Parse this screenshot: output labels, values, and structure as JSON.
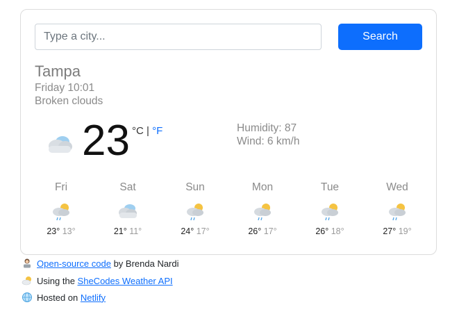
{
  "search": {
    "placeholder": "Type a city...",
    "value": "",
    "button_label": "Search"
  },
  "current": {
    "city": "Tampa",
    "datetime": "Friday 10:01",
    "description": "Broken clouds",
    "icon": "broken-clouds-icon",
    "temperature": "23",
    "unit_c": "°C",
    "unit_separator": " | ",
    "unit_f": "°F",
    "humidity": "Humidity: 87",
    "wind": "Wind: 6 km/h"
  },
  "forecast": [
    {
      "day": "Fri",
      "icon": "rain-sun-icon",
      "max": "23°",
      "min": "13°"
    },
    {
      "day": "Sat",
      "icon": "cloud-icon",
      "max": "21°",
      "min": "11°"
    },
    {
      "day": "Sun",
      "icon": "rain-sun-icon",
      "max": "24°",
      "min": "17°"
    },
    {
      "day": "Mon",
      "icon": "rain-sun-icon",
      "max": "26°",
      "min": "17°"
    },
    {
      "day": "Tue",
      "icon": "rain-sun-icon",
      "max": "26°",
      "min": "18°"
    },
    {
      "day": "Wed",
      "icon": "rain-sun-icon",
      "max": "27°",
      "min": "19°"
    }
  ],
  "footer": {
    "line1_icon": "woman-technologist-icon",
    "line1_link": "Open-source code",
    "line1_text": " by Brenda Nardi",
    "line2_icon": "sun-behind-cloud-icon",
    "line2_text": "Using the ",
    "line2_link": "SheCodes Weather API",
    "line3_icon": "globe-icon",
    "line3_text": "Hosted on ",
    "line3_link": "Netlify"
  },
  "colors": {
    "accent": "#0d6efd",
    "muted_text": "#8a8a8a",
    "card_border": "#dcdcdc"
  }
}
